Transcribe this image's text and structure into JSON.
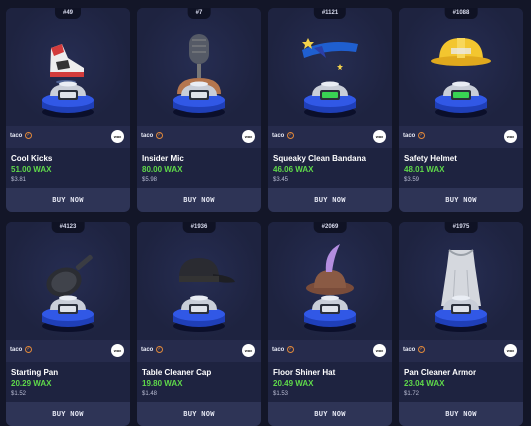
{
  "cards": [
    {
      "badge": "#49",
      "owner": "taco",
      "name": "Cool Kicks",
      "price": "51.00 WAX",
      "usd": "$3.81",
      "button": "BUY NOW",
      "item_icon": "sneaker-icon",
      "screen_color": "#dfe3ea"
    },
    {
      "badge": "#7",
      "owner": "taco",
      "name": "Insider Mic",
      "price": "80.00 WAX",
      "usd": "$5.98",
      "button": "BUY NOW",
      "item_icon": "microphone-icon",
      "screen_color": "#dfe3ea"
    },
    {
      "badge": "#1121",
      "owner": "taco",
      "name": "Squeaky Clean Bandana",
      "price": "46.06 WAX",
      "usd": "$3.45",
      "button": "BUY NOW",
      "item_icon": "bandana-icon",
      "screen_color": "#39d353"
    },
    {
      "badge": "#1088",
      "owner": "taco",
      "name": "Safety Helmet",
      "price": "48.01 WAX",
      "usd": "$3.59",
      "button": "BUY NOW",
      "item_icon": "helmet-icon",
      "screen_color": "#39d353"
    },
    {
      "badge": "#4123",
      "owner": "taco",
      "name": "Starting Pan",
      "price": "20.29 WAX",
      "usd": "$1.52",
      "button": "BUY NOW",
      "item_icon": "pan-icon",
      "screen_color": "#dfe3ea"
    },
    {
      "badge": "#1936",
      "owner": "taco",
      "name": "Table Cleaner Cap",
      "price": "19.80 WAX",
      "usd": "$1.48",
      "button": "BUY NOW",
      "item_icon": "cap-icon",
      "screen_color": "#dfe3ea"
    },
    {
      "badge": "#2069",
      "owner": "taco",
      "name": "Floor Shiner Hat",
      "price": "20.49 WAX",
      "usd": "$1.53",
      "button": "BUY NOW",
      "item_icon": "hat-icon",
      "screen_color": "#dfe3ea"
    },
    {
      "badge": "#1975",
      "owner": "taco",
      "name": "Pan Cleaner Armor",
      "price": "23.04 WAX",
      "usd": "$1.72",
      "button": "BUY NOW",
      "item_icon": "apron-icon",
      "screen_color": "#dfe3ea"
    }
  ],
  "colors": {
    "background": "#131628",
    "card": "#1e2340",
    "price": "#5fd94a",
    "verified": "#e0883a"
  }
}
